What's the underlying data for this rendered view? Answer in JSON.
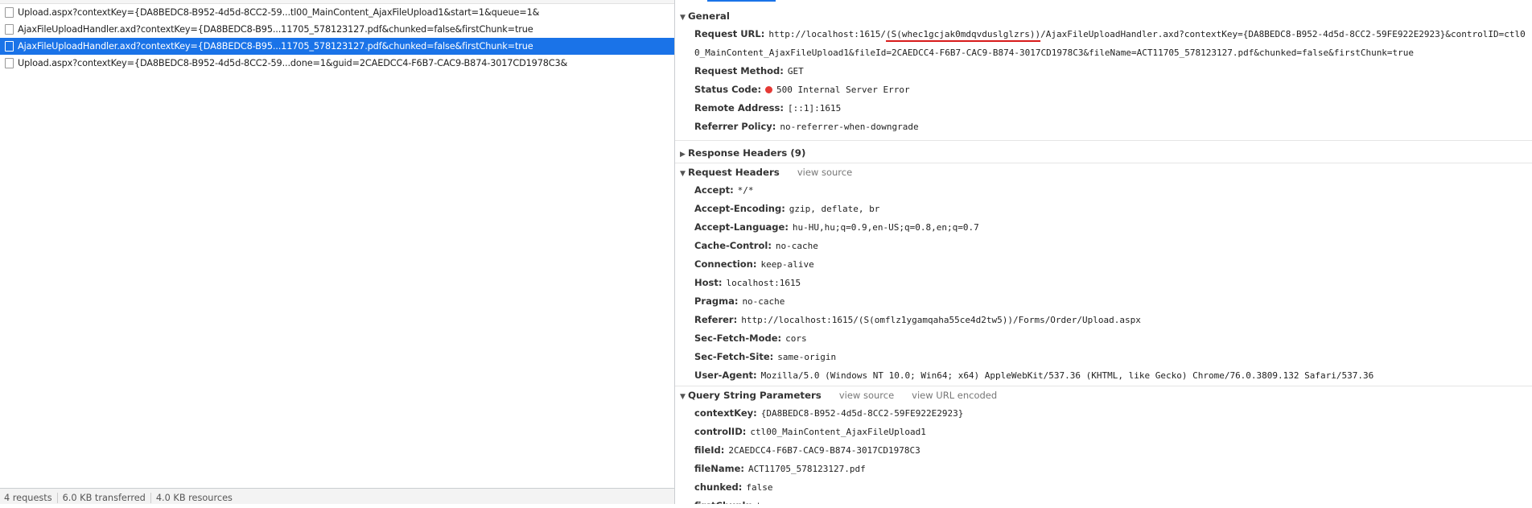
{
  "requests": [
    {
      "name": "Upload.aspx?contextKey={DA8BEDC8-B952-4d5d-8CC2-59...tl00_MainContent_AjaxFileUpload1&start=1&queue=1&",
      "selected": false
    },
    {
      "name": "AjaxFileUploadHandler.axd?contextKey={DA8BEDC8-B95...11705_578123127.pdf&chunked=false&firstChunk=true",
      "selected": false
    },
    {
      "name": "AjaxFileUploadHandler.axd?contextKey={DA8BEDC8-B95...11705_578123127.pdf&chunked=false&firstChunk=true",
      "selected": true
    },
    {
      "name": "Upload.aspx?contextKey={DA8BEDC8-B952-4d5d-8CC2-59...done=1&guid=2CAEDCC4-F6B7-CAC9-B874-3017CD1978C3&",
      "selected": false
    }
  ],
  "status_bar": {
    "requests": "4 requests",
    "transferred": "6.0 KB transferred",
    "resources": "4.0 KB resources"
  },
  "general": {
    "title": "General",
    "request_url_label": "Request URL:",
    "request_url_prefix": "http://localhost:1615/",
    "request_url_session": "(S(whec1gcjak0mdqvduslglzrs))",
    "request_url_rest": "/AjaxFileUploadHandler.axd?contextKey={DA8BEDC8-B952-4d5d-8CC2-59FE922E2923}&controlID=ctl00_MainContent_AjaxFileUpload1&fileId=2CAEDCC4-F6B7-CAC9-B874-3017CD1978C3&fileName=ACT11705_578123127.pdf&chunked=false&firstChunk=true",
    "request_method_label": "Request Method:",
    "request_method": "GET",
    "status_code_label": "Status Code:",
    "status_code": "500 Internal Server Error",
    "status_color": "#e53935",
    "remote_address_label": "Remote Address:",
    "remote_address": "[::1]:1615",
    "referrer_policy_label": "Referrer Policy:",
    "referrer_policy": "no-referrer-when-downgrade"
  },
  "response_headers": {
    "title": "Response Headers (9)"
  },
  "request_headers": {
    "title": "Request Headers",
    "view_source": "view source",
    "items": [
      {
        "key": "Accept:",
        "value": "*/*"
      },
      {
        "key": "Accept-Encoding:",
        "value": "gzip, deflate, br"
      },
      {
        "key": "Accept-Language:",
        "value": "hu-HU,hu;q=0.9,en-US;q=0.8,en;q=0.7"
      },
      {
        "key": "Cache-Control:",
        "value": "no-cache"
      },
      {
        "key": "Connection:",
        "value": "keep-alive"
      },
      {
        "key": "Host:",
        "value": "localhost:1615"
      },
      {
        "key": "Pragma:",
        "value": "no-cache"
      },
      {
        "key": "Referer:",
        "value": "http://localhost:1615/(S(omflz1ygamqaha55ce4d2tw5))/Forms/Order/Upload.aspx"
      },
      {
        "key": "Sec-Fetch-Mode:",
        "value": "cors"
      },
      {
        "key": "Sec-Fetch-Site:",
        "value": "same-origin"
      },
      {
        "key": "User-Agent:",
        "value": "Mozilla/5.0 (Windows NT 10.0; Win64; x64) AppleWebKit/537.36 (KHTML, like Gecko) Chrome/76.0.3809.132 Safari/537.36"
      }
    ]
  },
  "query_params": {
    "title": "Query String Parameters",
    "view_source": "view source",
    "view_url_encoded": "view URL encoded",
    "items": [
      {
        "key": "contextKey:",
        "value": "{DA8BEDC8-B952-4d5d-8CC2-59FE922E2923}"
      },
      {
        "key": "controlID:",
        "value": "ctl00_MainContent_AjaxFileUpload1"
      },
      {
        "key": "fileId:",
        "value": "2CAEDCC4-F6B7-CAC9-B874-3017CD1978C3"
      },
      {
        "key": "fileName:",
        "value": "ACT11705_578123127.pdf"
      },
      {
        "key": "chunked:",
        "value": "false"
      },
      {
        "key": "firstChunk:",
        "value": "true"
      }
    ]
  }
}
